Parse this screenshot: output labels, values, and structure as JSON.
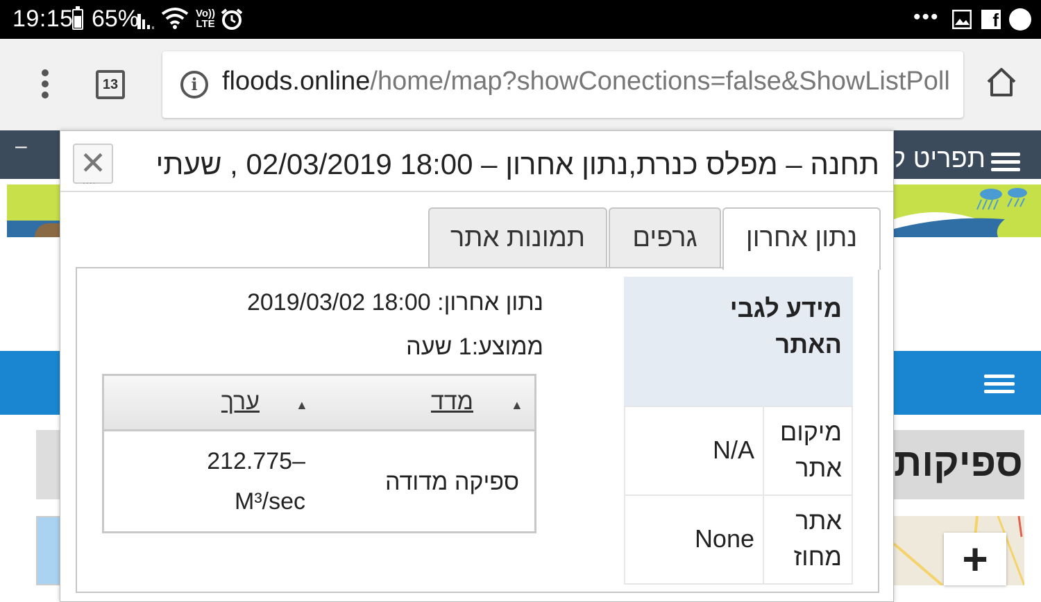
{
  "status_bar": {
    "time": "19:15",
    "battery": "65%",
    "volte_top": "Vo))",
    "volte_bottom": "LTE",
    "overflow": "•••"
  },
  "browser": {
    "tab_count": "13",
    "url_domain": "floods.online",
    "url_path": "/home/map?showConections=false&ShowListPoll"
  },
  "page": {
    "nav_menu_label": "תפריט ק",
    "nav_minus": "–",
    "heading": "ספיקות",
    "zoom_in": "+"
  },
  "dialog": {
    "title": "תחנה – מפלס כנרת,נתון אחרון – 18:00 02/03/2019 , שעתי",
    "close": "✕",
    "tabs": [
      {
        "label": "נתון אחרון",
        "active": true
      },
      {
        "label": "גרפים",
        "active": false
      },
      {
        "label": "תמונות אתר",
        "active": false
      }
    ],
    "last_data_label": "נתון אחרון:",
    "last_data_value": "18:00 2019/03/02",
    "average_label": "ממוצע:",
    "average_value": "1 שעה",
    "measurements": {
      "columns": [
        "מדד",
        "ערך"
      ],
      "rows": [
        {
          "metric": "ספיקה מדודה",
          "value_line1": "212.775–",
          "value_line2": "M³/sec"
        }
      ]
    },
    "site_info": {
      "header": "מידע לגבי האתר",
      "rows": [
        {
          "label": "מיקום אתר",
          "value": "N/A"
        },
        {
          "label": "אתר מחוז",
          "value": "None"
        }
      ]
    }
  }
}
